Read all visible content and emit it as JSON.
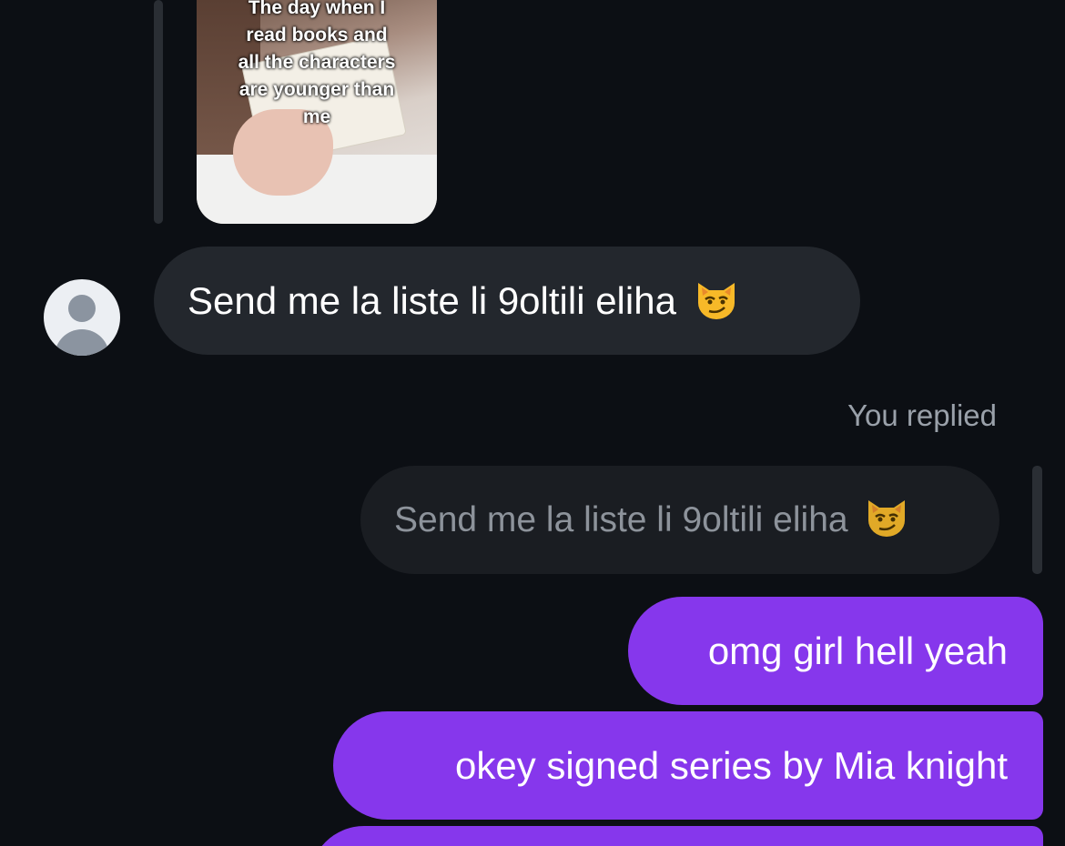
{
  "thread": {
    "shared_media": {
      "caption": "The day when I\nread books and\nall the characters\nare younger than\nme",
      "image_icon": "reel-thumbnail-image"
    },
    "incoming_message": {
      "avatar_icon": "default-user-avatar-icon",
      "text": "Send me la liste li 9oltili eliha",
      "emoji_icon": "smirking-cat-emoji"
    },
    "reply_context": {
      "label": "You replied",
      "quoted_text": "Send me la liste li 9oltili eliha",
      "emoji_icon": "smirking-cat-emoji"
    },
    "outgoing_messages": [
      {
        "text": "omg girl hell yeah"
      },
      {
        "text": "okey signed series by Mia knight"
      },
      {
        "text": ""
      }
    ]
  },
  "colors": {
    "background": "#0c0f14",
    "incoming_bubble": "#23272d",
    "quoted_bubble": "#1a1d22",
    "outgoing_bubble": "#8637ec",
    "muted_text": "#9aa1aa"
  }
}
